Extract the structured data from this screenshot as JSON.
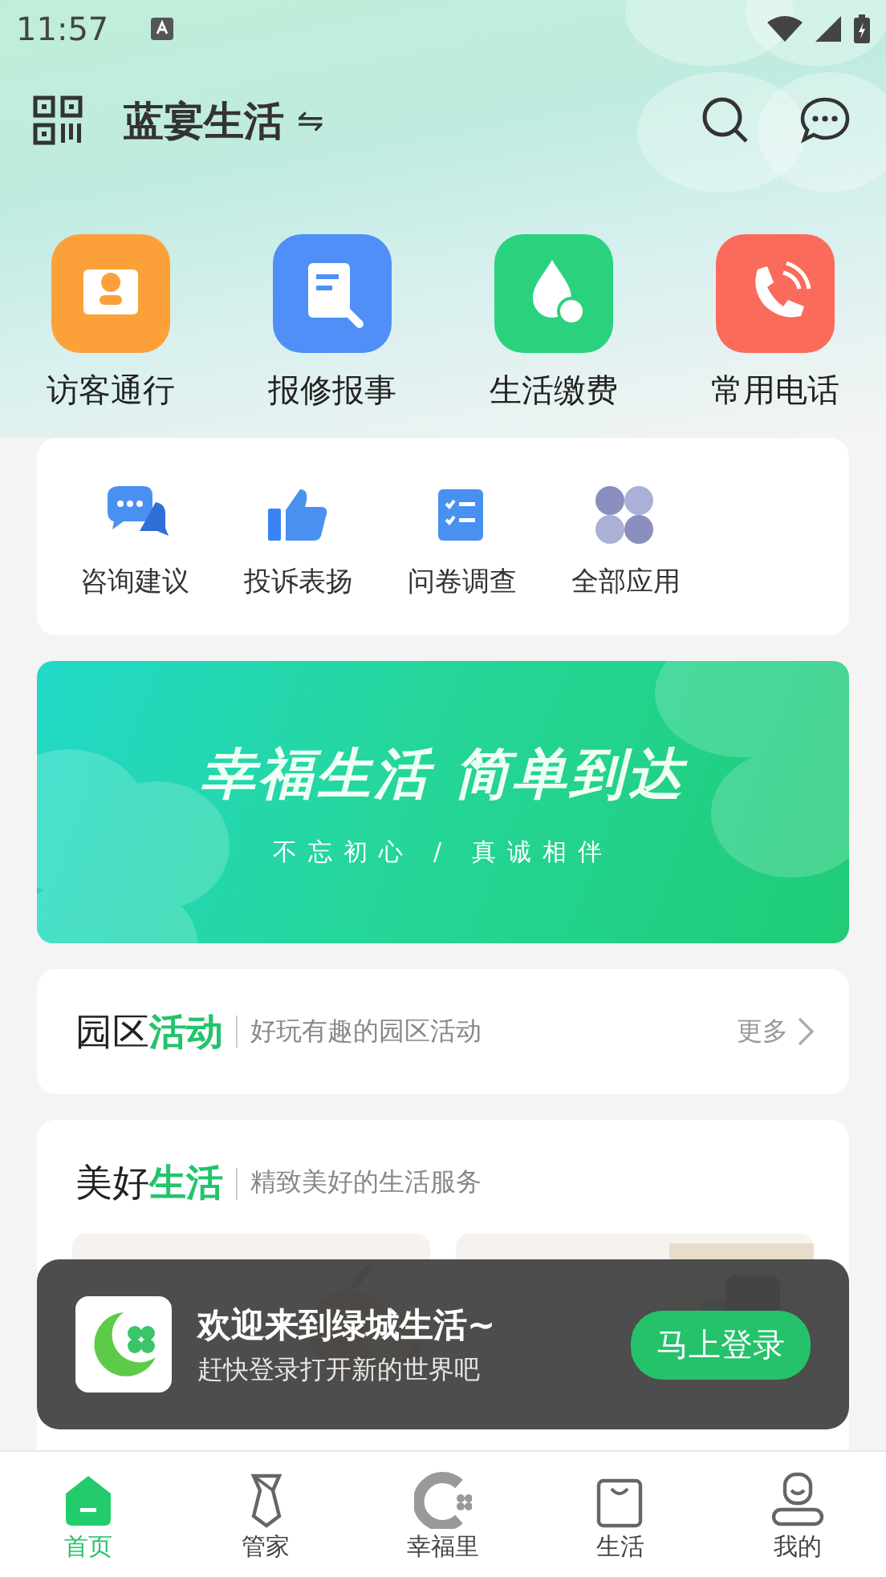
{
  "status_bar": {
    "time": "11:57"
  },
  "header": {
    "title": "蓝宴生活",
    "switch_glyph": "⇋"
  },
  "quick_actions": [
    {
      "label": "访客通行",
      "color": "#fca13a"
    },
    {
      "label": "报修报事",
      "color": "#4f8ff7"
    },
    {
      "label": "生活缴费",
      "color": "#2bd27e"
    },
    {
      "label": "常用电话",
      "color": "#fb6b5b"
    }
  ],
  "services": [
    {
      "label": "咨询建议"
    },
    {
      "label": "投诉表扬"
    },
    {
      "label": "问卷调查"
    },
    {
      "label": "全部应用"
    }
  ],
  "banner": {
    "headline": "幸福生活 简单到达",
    "tagline": "不忘初心 / 真诚相伴"
  },
  "activity_section": {
    "title": "园区",
    "title_accent": "活动",
    "subtitle": "好玩有趣的园区活动",
    "more": "更多"
  },
  "life_section": {
    "title": "美好",
    "title_accent": "生活",
    "subtitle": "精致美好的生活服务"
  },
  "toast": {
    "title": "欢迎来到绿城生活~",
    "subtitle": "赶快登录打开新的世界吧",
    "button": "马上登录"
  },
  "tabs": [
    {
      "label": "首页",
      "selected": true
    },
    {
      "label": "管家",
      "selected": false
    },
    {
      "label": "幸福里",
      "selected": false
    },
    {
      "label": "生活",
      "selected": false
    },
    {
      "label": "我的",
      "selected": false
    }
  ]
}
